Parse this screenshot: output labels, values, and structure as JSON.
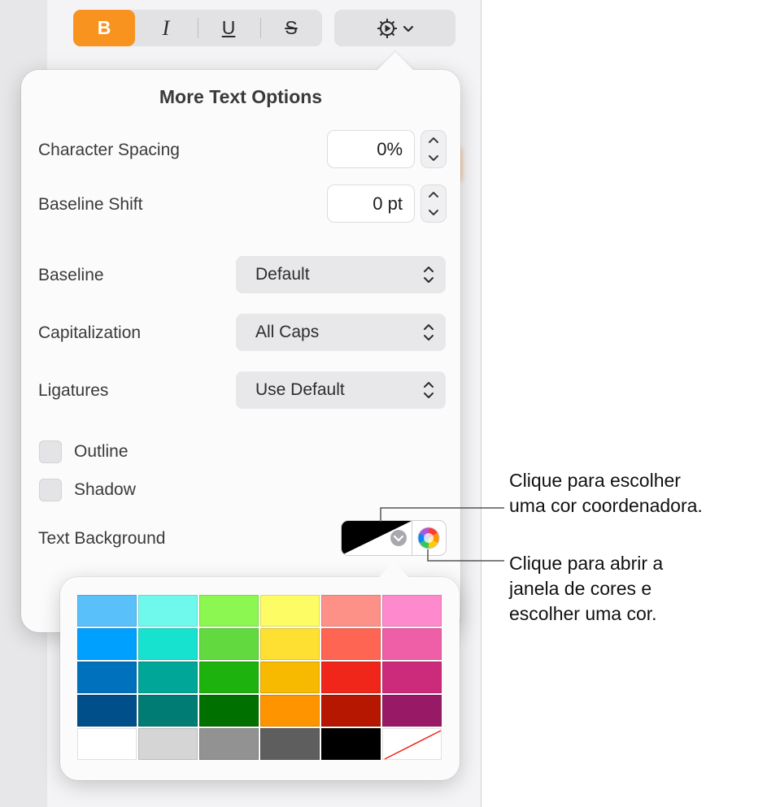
{
  "toolbar": {
    "bold_label": "B",
    "italic_label": "I",
    "underline_label": "U",
    "strikethrough_label": "S",
    "gear_icon": "gear-icon",
    "chevron_icon": "chevron-down-icon",
    "accent_color": "#f7931e"
  },
  "popover": {
    "title": "More Text Options",
    "character_spacing": {
      "label": "Character Spacing",
      "value": "0%"
    },
    "baseline_shift": {
      "label": "Baseline Shift",
      "value": "0 pt"
    },
    "baseline": {
      "label": "Baseline",
      "value": "Default"
    },
    "capitalization": {
      "label": "Capitalization",
      "value": "All Caps"
    },
    "ligatures": {
      "label": "Ligatures",
      "value": "Use Default"
    },
    "outline": {
      "label": "Outline",
      "checked": false
    },
    "shadow": {
      "label": "Shadow",
      "checked": false
    },
    "text_background": {
      "label": "Text Background",
      "well_colors": [
        "#000000",
        "#ffffff"
      ]
    }
  },
  "palette": {
    "rows": [
      [
        "#5ac0fa",
        "#6ff9ec",
        "#8df752",
        "#fefc65",
        "#fe9187",
        "#fe89cc"
      ],
      [
        "#00a1fe",
        "#17e2cf",
        "#61d93f",
        "#fee032",
        "#fe6552",
        "#ee5fa8"
      ],
      [
        "#0071bc",
        "#00a697",
        "#1db20d",
        "#f8ba00",
        "#ef2619",
        "#cc2a7b"
      ],
      [
        "#004f8a",
        "#007c74",
        "#007100",
        "#fe9400",
        "#b51700",
        "#981a67"
      ],
      [
        "#ffffff",
        "#d5d5d5",
        "#929292",
        "#5e5e5e",
        "#000000",
        "none"
      ]
    ]
  },
  "callouts": {
    "coordinating_color": [
      "Clique para escolher",
      "uma cor coordenadora."
    ],
    "color_window": [
      "Clique para abrir a",
      "janela de cores e",
      "escolher uma cor."
    ]
  }
}
